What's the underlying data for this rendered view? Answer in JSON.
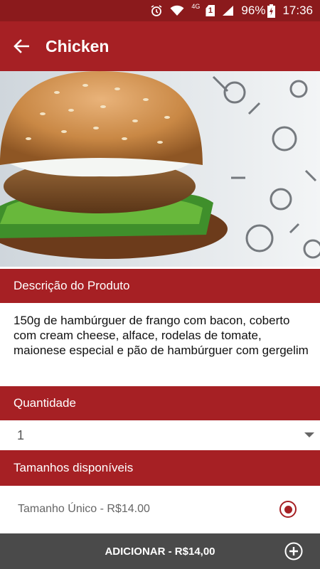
{
  "status_bar": {
    "network": "4G",
    "sim": "1",
    "battery": "96%",
    "time": "17:36"
  },
  "app_bar": {
    "title": "Chicken",
    "back_icon": "arrow-left-icon"
  },
  "product": {
    "image": "chicken-burger-photo",
    "description_header": "Descrição do Produto",
    "description": "150g de hambúrguer de frango com bacon, coberto com cream cheese, alface, rodelas de tomate, maionese especial e pão de hambúrguer com gergelim"
  },
  "quantity": {
    "header": "Quantidade",
    "selected": "1"
  },
  "sizes": {
    "header": "Tamanhos disponíveis",
    "options": [
      {
        "label": "Tamanho Único - R$14.00",
        "selected": true
      }
    ]
  },
  "add_button": {
    "label": "ADICIONAR - R$14,00",
    "icon": "plus-circle-icon"
  },
  "colors": {
    "primary": "#a62024",
    "status_bar": "#8b1a1c",
    "bottom_bar": "#4a4a4a"
  }
}
